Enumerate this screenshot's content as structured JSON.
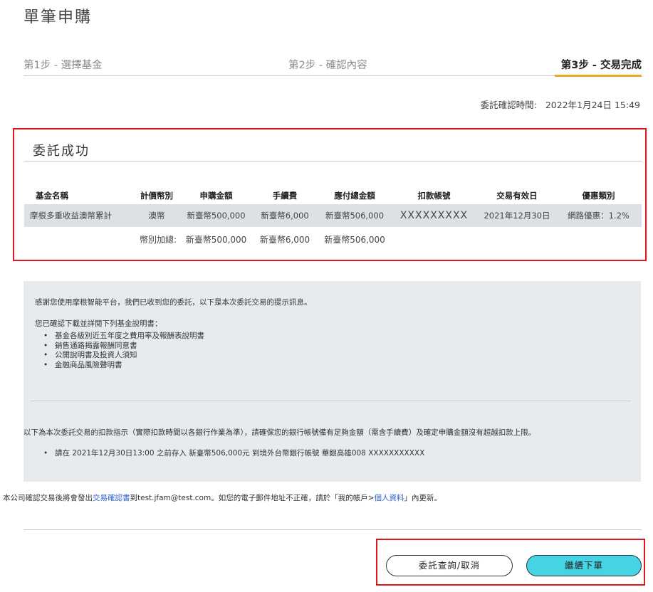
{
  "page": {
    "title": "單筆申購"
  },
  "steps": [
    {
      "label": "第1步 - 選擇基金"
    },
    {
      "label": "第2步 - 確認內容"
    },
    {
      "label": "第3步 - 交易完成"
    }
  ],
  "confirm": {
    "label": "委託確認時間:",
    "value": "2022年1月24日 15:49"
  },
  "result": {
    "title": "委託成功"
  },
  "table": {
    "headers": [
      "基金名稱",
      "計價幣別",
      "申購金額",
      "手續費",
      "應付總金額",
      "扣款帳號",
      "交易有效日",
      "優惠類別"
    ],
    "row": [
      "摩根多重收益澳幣累計",
      "澳幣",
      "新臺幣500,000",
      "新臺幣6,000",
      "新臺幣506,000",
      "XXXXXXXXX",
      "2021年12月30日",
      "網路優惠：1.2%"
    ],
    "total": {
      "label": "幣別加總:",
      "amount": "新臺幣500,000",
      "fee": "新臺幣6,000",
      "payable": "新臺幣506,000"
    }
  },
  "notice": {
    "thanks": "感謝您使用摩根智能平台，我們已收到您的委託，以下是本次委託交易的提示訊息。",
    "downloaded": "您已確認下載並詳閱下列基金說明書：",
    "docs": [
      "基金各級別近五年度之費用率及報酬表說明書",
      "銷售通路揭露報酬同意書",
      "公開說明書及投資人須知",
      "金融商品風險聲明書"
    ],
    "instruction": "以下為本次委託交易的扣款指示（實際扣款時間以各銀行作業為準），請確保您的銀行帳號備有足夠金額（需含手續費）及確定申購金額沒有超越扣款上限。",
    "deposit": "請在 2021年12月30日13:00 之前存入 新臺幣506,000元 到境外台幣銀行帳號 華銀高雄008   XXXXXXXXXXX"
  },
  "email": {
    "prefix": "本公司確認交易後將會發出",
    "link1": "交易確認書",
    "middle": "到test.jfam@test.com。如您的電子郵件地址不正確，請於「我的帳戶>",
    "link2": "個人資料",
    "suffix": "」內更新。"
  },
  "buttons": {
    "query": "委託查詢/取消",
    "continue": "繼續下單"
  },
  "colors": {
    "accent": "#f0a823",
    "button": "#44d4e4",
    "highlight": "#e0161e"
  }
}
